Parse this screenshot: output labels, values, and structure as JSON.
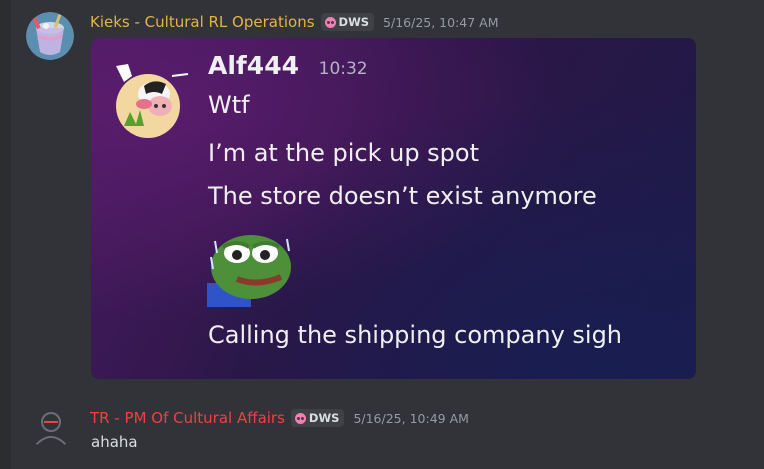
{
  "messages": [
    {
      "author": "Kieks - Cultural RL Operations",
      "author_color": "#e5b347",
      "tag": "DWS",
      "timestamp": "5/16/25, 10:47 AM",
      "embed": {
        "author": "Alf444",
        "time": "10:32",
        "lines": [
          "Wtf",
          "I’m at the pick up spot",
          "The store doesn’t exist anymore",
          "Calling the shipping company sigh"
        ],
        "emoji": "pepe-sweat-emoji"
      }
    },
    {
      "author": "TR - PM Of Cultural Affairs",
      "author_color": "#f23f42",
      "tag": "DWS",
      "timestamp": "5/16/25, 10:49 AM",
      "text": "ahaha"
    }
  ],
  "colors": {
    "background": "#313338",
    "text": "#dbdee1",
    "muted": "#949ba4"
  }
}
